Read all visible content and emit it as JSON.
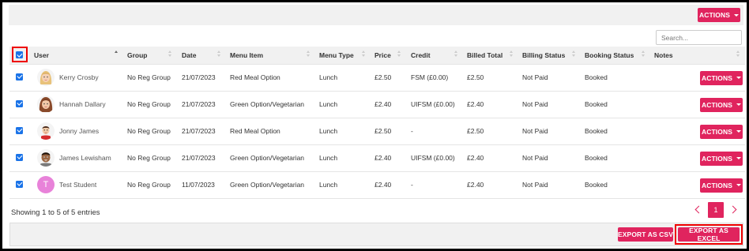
{
  "header": {
    "actions_label": "ACTIONS",
    "search_placeholder": "Search..."
  },
  "columns": {
    "user": "User",
    "group": "Group",
    "date": "Date",
    "menu_item": "Menu Item",
    "menu_type": "Menu Type",
    "price": "Price",
    "credit": "Credit",
    "billed_total": "Billed Total",
    "billing_status": "Billing Status",
    "booking_status": "Booking Status",
    "notes": "Notes"
  },
  "rows": [
    {
      "avatar": "girl-blonde-avatar",
      "user": "Kerry Crosby",
      "group": "No Reg Group",
      "date": "21/07/2023",
      "menu_item": "Red Meal Option",
      "menu_type": "Lunch",
      "price": "£2.50",
      "credit": "FSM (£0.00)",
      "billed_total": "£2.50",
      "billing_status": "Not Paid",
      "booking_status": "Booked",
      "notes": "",
      "actions": "ACTIONS"
    },
    {
      "avatar": "girl-brown-avatar",
      "user": "Hannah Dallary",
      "group": "No Reg Group",
      "date": "21/07/2023",
      "menu_item": "Green Option/Vegetarian",
      "menu_type": "Lunch",
      "price": "£2.40",
      "credit": "UIFSM (£0.00)",
      "billed_total": "£2.40",
      "billing_status": "Not Paid",
      "booking_status": "Booked",
      "notes": "",
      "actions": "ACTIONS"
    },
    {
      "avatar": "boy-red-avatar",
      "user": "Jonny James",
      "group": "No Reg Group",
      "date": "21/07/2023",
      "menu_item": "Red Meal Option",
      "menu_type": "Lunch",
      "price": "£2.50",
      "credit": "-",
      "billed_total": "£2.50",
      "billing_status": "Not Paid",
      "booking_status": "Booked",
      "notes": "",
      "actions": "ACTIONS"
    },
    {
      "avatar": "boy-dark-avatar",
      "user": "James Lewisham",
      "group": "No Reg Group",
      "date": "21/07/2023",
      "menu_item": "Green Option/Vegetarian",
      "menu_type": "Lunch",
      "price": "£2.40",
      "credit": "UIFSM (£0.00)",
      "billed_total": "£2.40",
      "billing_status": "Not Paid",
      "booking_status": "Booked",
      "notes": "",
      "actions": "ACTIONS"
    },
    {
      "avatar": "letter-avatar",
      "avatar_letter": "T",
      "user": "Test Student",
      "group": "No Reg Group",
      "date": "11/07/2023",
      "menu_item": "Green Option/Vegetarian",
      "menu_type": "Lunch",
      "price": "£2.40",
      "credit": "-",
      "billed_total": "£2.40",
      "billing_status": "Not Paid",
      "booking_status": "Booked",
      "notes": "",
      "actions": "ACTIONS"
    }
  ],
  "footer": {
    "entries_text": "Showing 1 to 5 of 5 entries",
    "current_page": "1"
  },
  "export": {
    "csv_label": "EXPORT AS CSV",
    "excel_label": "EXPORT AS EXCEL"
  },
  "colors": {
    "accent": "#e0245e",
    "checkbox": "#1a73e8",
    "highlight": "#ee0000"
  }
}
